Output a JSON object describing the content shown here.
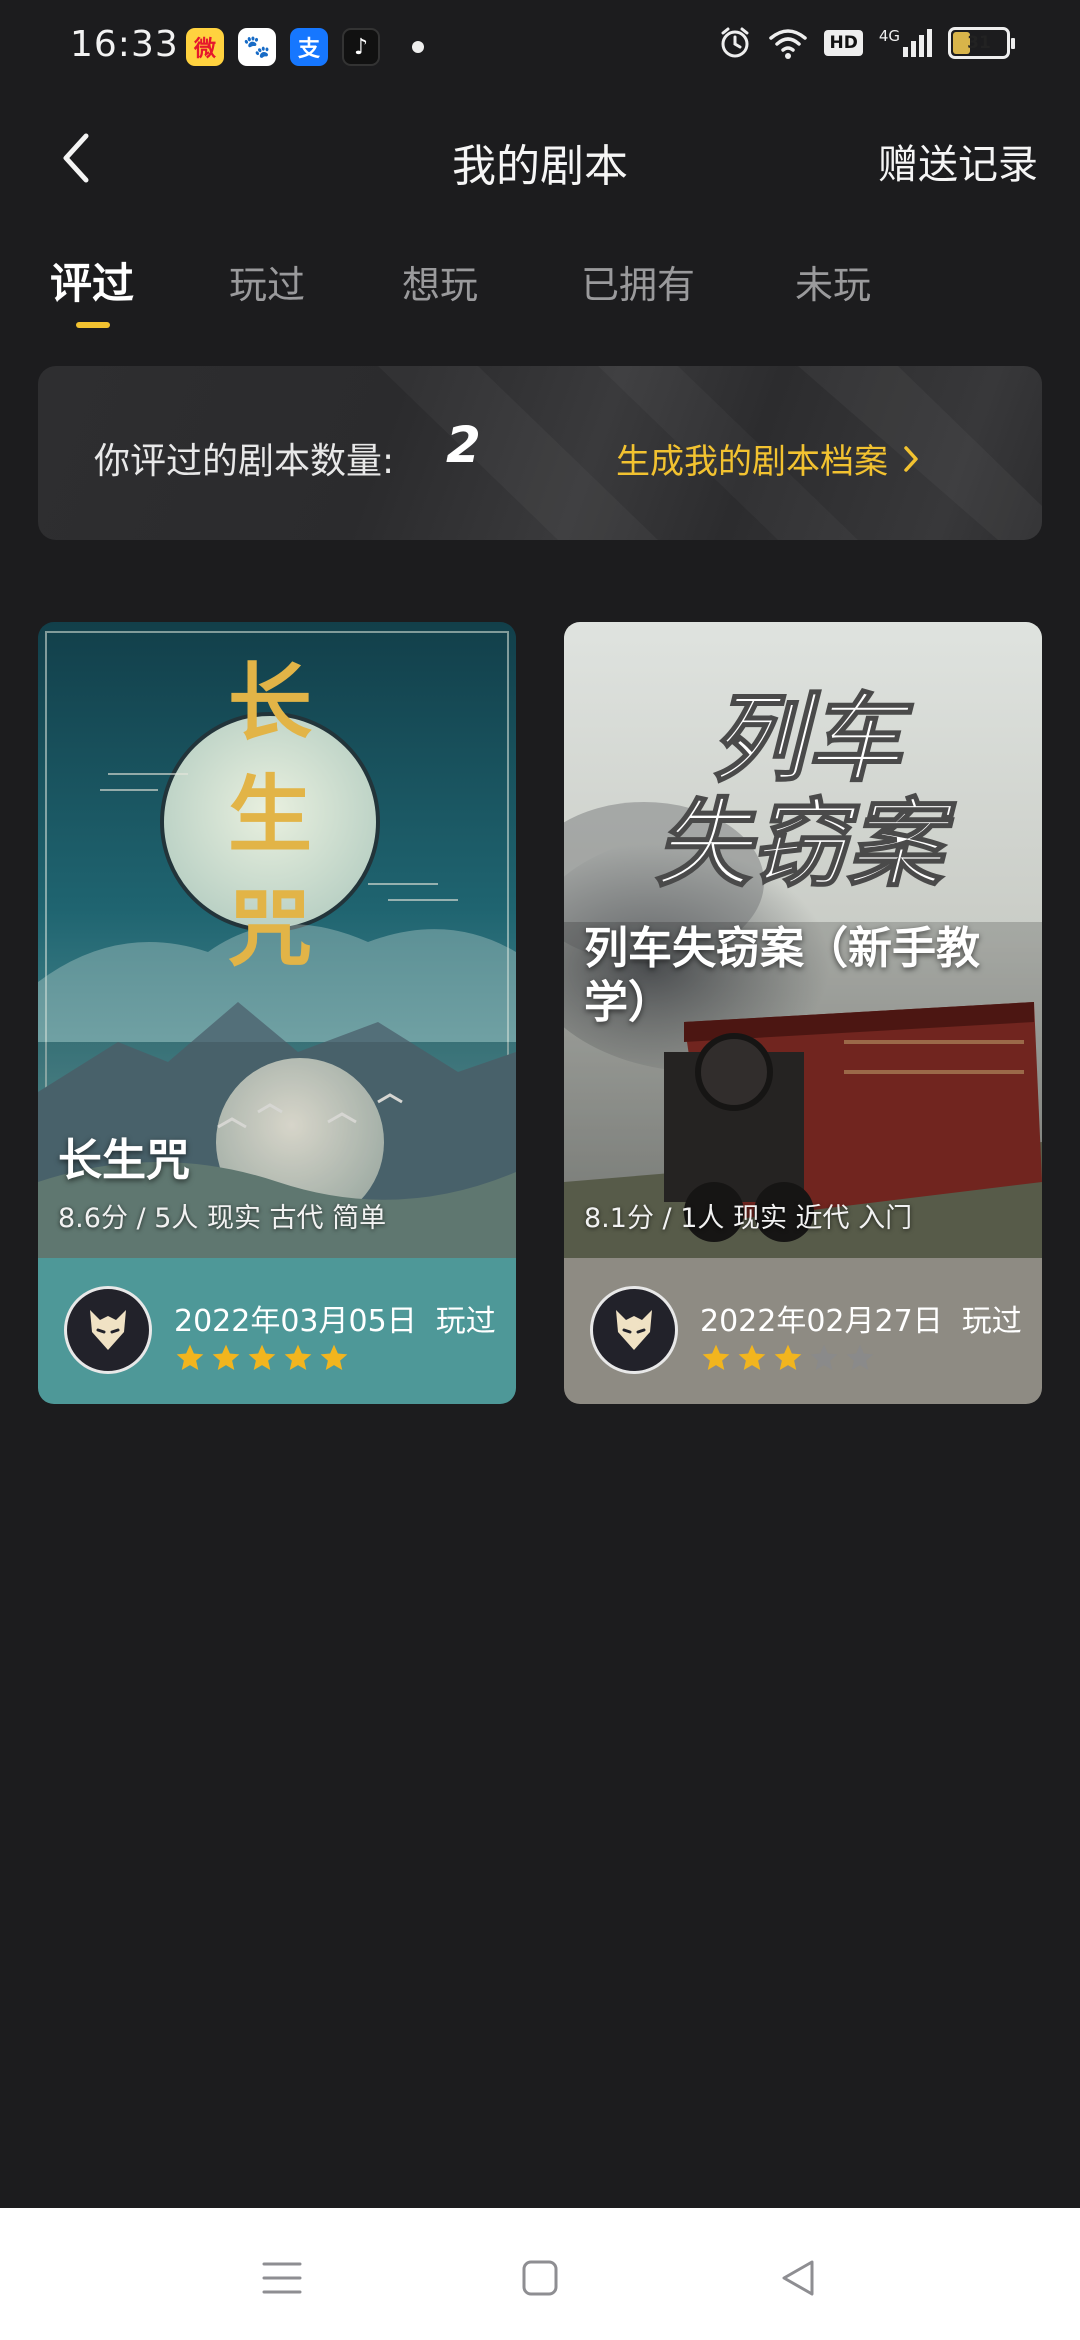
{
  "status_bar": {
    "time": "16:33",
    "apps": [
      "weibo-icon",
      "baidu-icon",
      "alipay-icon",
      "douyin-icon"
    ],
    "network": "4G",
    "hd": "HD",
    "battery": "31",
    "battery_level": 0.31
  },
  "header": {
    "title": "我的剧本",
    "right_action": "赠送记录"
  },
  "tabs": [
    {
      "label": "评过",
      "active": true
    },
    {
      "label": "玩过",
      "active": false
    },
    {
      "label": "想玩",
      "active": false
    },
    {
      "label": "已拥有",
      "active": false
    },
    {
      "label": "未玩",
      "active": false
    }
  ],
  "summary": {
    "label": "你评过的剧本数量:",
    "count": "2",
    "link_text": "生成我的剧本档案"
  },
  "cards": [
    {
      "poster_text": "长生咒",
      "title": "长生咒",
      "meta": "8.6分  /  5人  现实 古代 简单",
      "date": "2022年03月05日",
      "status": "玩过",
      "rating": 5,
      "footer_color": "#4e9898"
    },
    {
      "poster_text_line1": "列车",
      "poster_text_line2": "失窃案",
      "title": "列车失窃案（新手教学）",
      "meta": "8.1分  /  1人  现实 近代 入门",
      "date": "2022年02月27日",
      "status": "玩过",
      "rating": 3,
      "footer_color": "#8e8b83"
    }
  ],
  "colors": {
    "accent": "#f2c230",
    "background": "#1c1c1e",
    "star_on": "#f2b51e",
    "star_off": "#8a8a8a"
  }
}
